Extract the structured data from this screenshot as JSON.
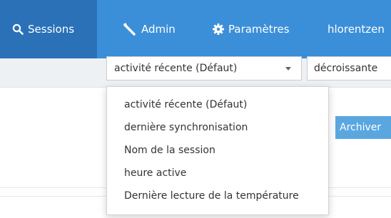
{
  "nav": {
    "sessions_label": "Sessions",
    "admin_label": "Admin",
    "settings_label": "Paramètres",
    "user_label": "hlorentzen"
  },
  "toolbar": {
    "sort_select_value": "activité récente (Défaut)",
    "order_select_value": "décroissante"
  },
  "content": {
    "archive_button_label": "Archiver"
  },
  "sort_menu": {
    "items": [
      "activité récente (Défaut)",
      "dernière synchronisation",
      "Nom de la session",
      "heure active",
      "Dernière lecture de la température"
    ]
  },
  "colors": {
    "navbar": "#3b8fd9",
    "navbar_active": "#2a71b8",
    "toolbar": "#eef1f3",
    "button": "#5aa7e0"
  },
  "icons": {
    "sessions": "search-icon",
    "admin": "wrench-icon",
    "settings": "gear-icon",
    "sort_select": "caret-down-icon"
  }
}
